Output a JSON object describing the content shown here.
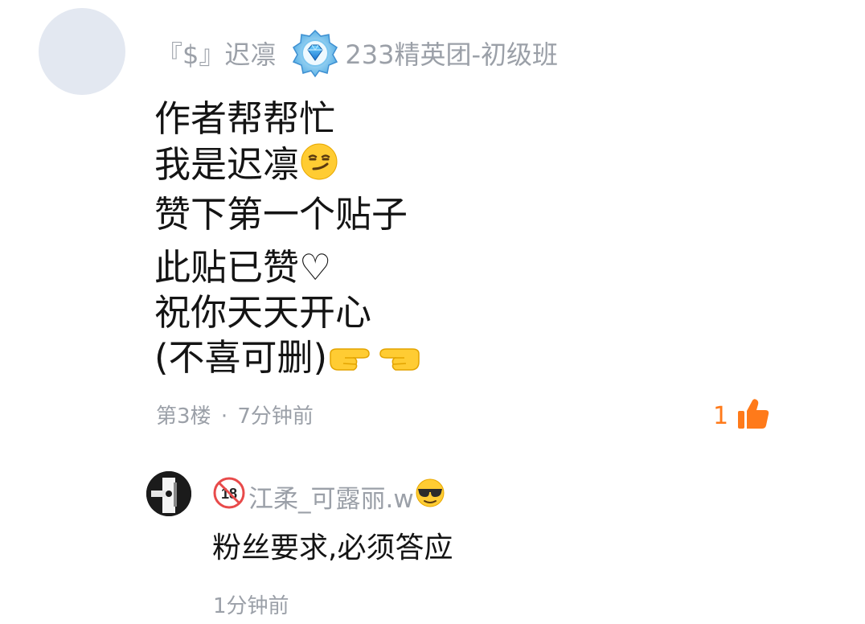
{
  "comment": {
    "username": "『$』迟凛",
    "group_badge_icon": "diamond-rank-icon",
    "group_name": "233精英团-初级班",
    "lines": [
      "作者帮帮忙",
      "我是迟凛",
      "赞下第一个贴子",
      "此贴已赞♡",
      "祝你天天开心",
      "(不喜可删)"
    ],
    "emojis": {
      "smirk": "smirk-emoji",
      "point_right": "pointing-right-emoji",
      "point_left": "pointing-left-emoji"
    },
    "floor": "第3楼",
    "separator": "·",
    "time": "7分钟前",
    "like_count": "1",
    "like_icon": "thumbs-up-icon",
    "like_color": "#ff7a1a"
  },
  "reply": {
    "age_badge_icon": "age-18-icon",
    "username": "江柔_可露丽.w",
    "username_emoji": "sunglasses-emoji",
    "text": "粉丝要求,必须答应",
    "time": "1分钟前"
  },
  "colors": {
    "meta_gray": "#9ba0a8",
    "text_dark": "#141414",
    "avatar_placeholder": "#e3e8f1"
  }
}
